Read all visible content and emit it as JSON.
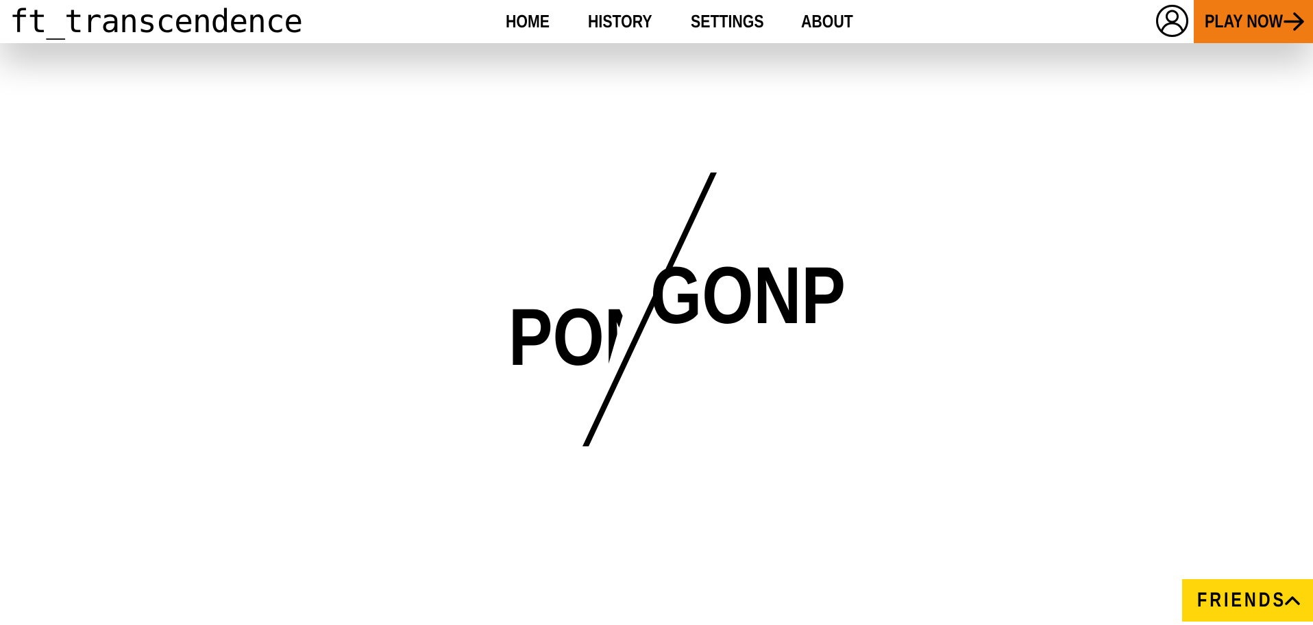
{
  "header": {
    "brand": "ft_transcendence",
    "nav": [
      {
        "label": "HOME"
      },
      {
        "label": "HISTORY"
      },
      {
        "label": "SETTINGS"
      },
      {
        "label": "ABOUT"
      }
    ],
    "profile_icon": "user-circle-icon",
    "play_label": "PLAY NOW",
    "play_icon": "arrow-right-icon",
    "play_color": "#f07b12"
  },
  "hero": {
    "word_left": "PONG",
    "word_right": "GONP"
  },
  "friends": {
    "label": "FRIENDS",
    "icon": "chevron-up-icon",
    "color": "#ffd60a"
  }
}
